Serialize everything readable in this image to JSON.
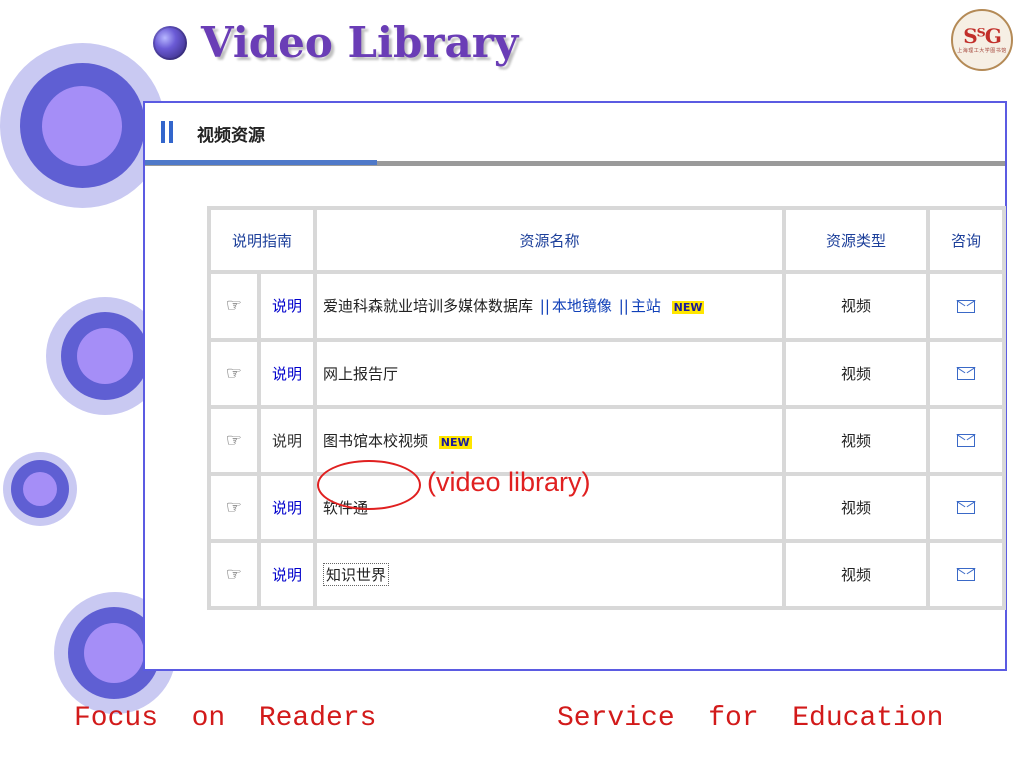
{
  "slide": {
    "title": "Video Library",
    "logo_letters": "SᵀG",
    "logo_caption": "上海理工大学图书馆",
    "footer_left": "Focus  on  Readers",
    "footer_right": "Service  for  Education"
  },
  "panel": {
    "header_title": "视频资源",
    "columns": {
      "guide": "说明指南",
      "name": "资源名称",
      "type": "资源类型",
      "ask": "咨询"
    },
    "rows": [
      {
        "explain": "说明",
        "name": "爱迪科森就业培训多媒体数据库",
        "link1": "本地镜像",
        "link2": "主站",
        "badge": "NEW",
        "type": "视频"
      },
      {
        "explain": "说明",
        "name": "网上报告厅",
        "type": "视频"
      },
      {
        "explain": "说明",
        "name": "图书馆本校视频",
        "badge": "NEW",
        "type": "视频"
      },
      {
        "explain": "说明",
        "name": "软件通",
        "type": "视频"
      },
      {
        "explain": "说明",
        "name": "知识世界",
        "type": "视频"
      }
    ]
  },
  "annotation": {
    "text": "(video library)"
  },
  "colors": {
    "title": "#6a3db6",
    "panel_border": "#5b5be2",
    "annotation": "#e02020",
    "footer": "#d21a1a"
  }
}
